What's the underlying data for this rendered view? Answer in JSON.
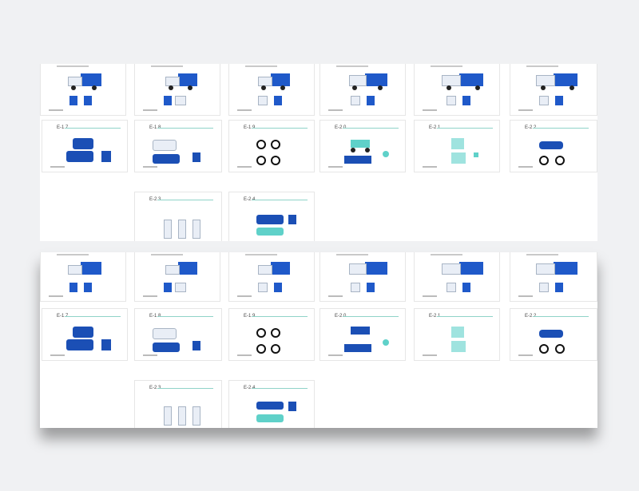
{
  "codes": {
    "e17": "E-1.7",
    "e18": "E-1.8",
    "e19": "E-1.9",
    "e20": "E-2.0",
    "e21": "E-2.1",
    "e22": "E-2.2",
    "e23": "E-2.3",
    "e24": "E-2.4"
  },
  "colors": {
    "brand_blue": "#1f59c9",
    "accent_teal": "#5fd1c9",
    "background": "#f0f1f3"
  },
  "icons": [
    "truck-icon",
    "van-icon",
    "bicycle-icon",
    "tricycle-icon",
    "motorcycle-icon",
    "bus-icon",
    "signboard-icon"
  ]
}
